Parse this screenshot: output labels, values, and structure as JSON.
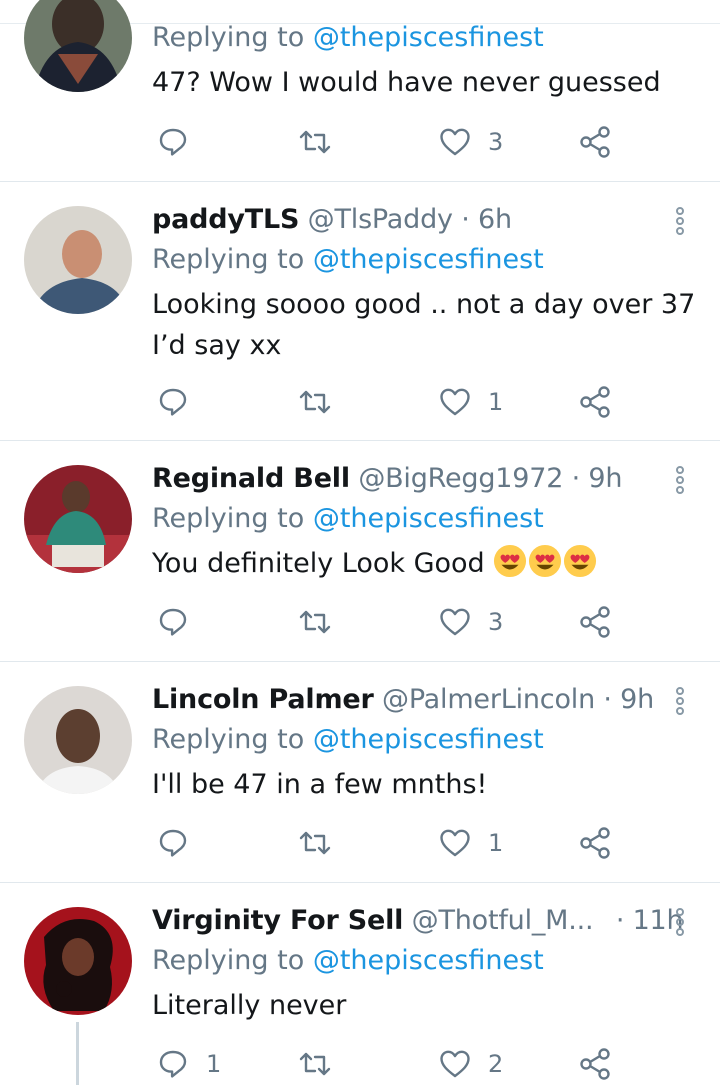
{
  "tweets": [
    {
      "name": "",
      "handle": "",
      "time": "",
      "replying_prefix": "Replying to",
      "replying_to": "@thepiscesfinest",
      "text_lines": [
        "47? Wow I would have never guessed"
      ],
      "replies": "",
      "likes": "3"
    },
    {
      "name": "paddyTLS",
      "handle": "@TlsPaddy",
      "time": "· 6h",
      "replying_prefix": "Replying to",
      "replying_to": "@thepiscesfinest",
      "text_lines": [
        "Looking soooo good ..  not a day over 37",
        "I’d say xx"
      ],
      "replies": "",
      "likes": "1"
    },
    {
      "name": "Reginald Bell",
      "handle": "@BigRegg1972",
      "time": "· 9h",
      "replying_prefix": "Replying to",
      "replying_to": "@thepiscesfinest",
      "text_lines": [
        "You definitely Look Good "
      ],
      "emoji": [
        "heart-eyes-emoji",
        "heart-eyes-emoji",
        "heart-eyes-emoji"
      ],
      "replies": "",
      "likes": "3"
    },
    {
      "name": "Lincoln Palmer",
      "handle": "@PalmerLincoln",
      "time": "· 9h",
      "replying_prefix": "Replying to",
      "replying_to": "@thepiscesfinest",
      "text_lines": [
        "I'll be 47 in a few mnths!"
      ],
      "replies": "",
      "likes": "1"
    },
    {
      "name": "Virginity For Sell",
      "handle": "@Thotful_M...",
      "time": "· 11h",
      "replying_prefix": "Replying to",
      "replying_to": "@thepiscesfinest",
      "text_lines": [
        "Literally never"
      ],
      "replies": "1",
      "likes": "2"
    }
  ],
  "icons": [
    "reply-icon",
    "retweet-icon",
    "like-icon",
    "share-icon",
    "more-options-icon"
  ],
  "colors": {
    "accent": "#1b95e0",
    "secondary_text": "#657786",
    "primary_text": "#14171a",
    "divider": "#e1e8ed"
  }
}
